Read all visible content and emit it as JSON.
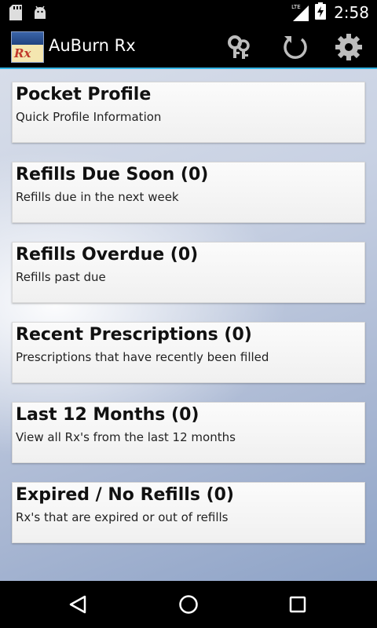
{
  "status_bar": {
    "network_label": "LTE",
    "time": "2:58",
    "icons": [
      "sd-card-icon",
      "android-debug-icon",
      "lte-signal-icon",
      "battery-charging-icon"
    ]
  },
  "action_bar": {
    "title": "AuBurn Rx",
    "logo_text": "Rx",
    "actions": [
      "keys-icon",
      "refresh-icon",
      "settings-gear-icon"
    ],
    "accent_color": "#33b5e5"
  },
  "menu": {
    "items": [
      {
        "title": "Pocket Profile",
        "subtitle": "Quick Profile Information"
      },
      {
        "title": "Refills Due Soon (0)",
        "subtitle": "Refills due in the next week"
      },
      {
        "title": "Refills Overdue (0)",
        "subtitle": "Refills past due"
      },
      {
        "title": "Recent Prescriptions (0)",
        "subtitle": "Prescriptions that have recently been filled"
      },
      {
        "title": "Last 12 Months (0)",
        "subtitle": "View all Rx's from the last 12 months"
      },
      {
        "title": "Expired / No Refills (0)",
        "subtitle": "Rx's that are expired or out of refills"
      }
    ]
  },
  "nav_bar": {
    "buttons": [
      "back-icon",
      "home-icon",
      "recents-icon"
    ]
  }
}
